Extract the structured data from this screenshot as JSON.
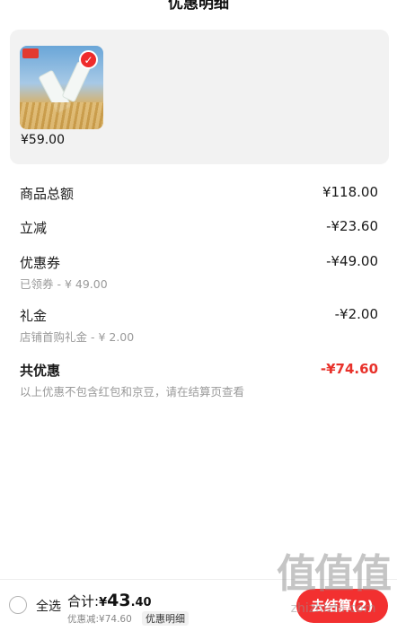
{
  "header": {
    "title": "优惠明细"
  },
  "product": {
    "price": "¥59.00",
    "selected": true
  },
  "breakdown": {
    "goods_total": {
      "label": "商品总额",
      "value": "¥118.00"
    },
    "instant_discount": {
      "label": "立减",
      "value": "-¥23.60"
    },
    "coupon": {
      "label": "优惠券",
      "value": "-¥49.00",
      "sub": "已领券 - ¥ 49.00"
    },
    "gift_money": {
      "label": "礼金",
      "value": "-¥2.00",
      "sub": "店铺首购礼金 - ¥ 2.00"
    },
    "total_discount": {
      "label": "共优惠",
      "value": "-¥74.60",
      "sub": "以上优惠不包含红包和京豆，请在结算页查看"
    }
  },
  "footer": {
    "select_all": "全选",
    "sum_prefix": "合计:",
    "sum_currency": "¥",
    "sum_integer": "43",
    "sum_decimal": ".40",
    "discount_summary": "优惠减:¥74.60",
    "detail_link": "优惠明细",
    "checkout_label": "去结算(2)"
  },
  "watermark": {
    "glyphs": "值值值",
    "url": "zhizhizhi.com"
  },
  "colors": {
    "accent": "#f23030",
    "discount_red": "#e8322b",
    "card_bg": "#f2f2f2"
  }
}
